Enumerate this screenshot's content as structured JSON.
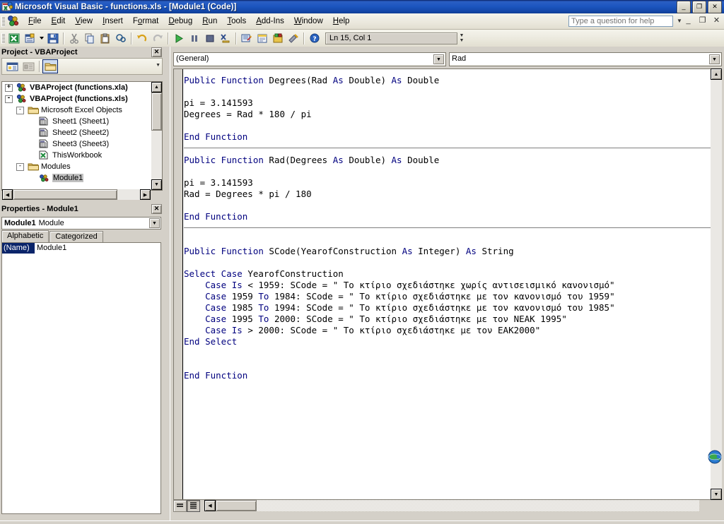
{
  "window": {
    "title": "Microsoft Visual Basic - functions.xls - [Module1 (Code)]",
    "app_icon": "vb-excel-icon",
    "buttons": {
      "minimize": "_",
      "restore": "❐",
      "close": "✕"
    }
  },
  "menubar": {
    "items": [
      {
        "label": "File",
        "accel": "F"
      },
      {
        "label": "Edit",
        "accel": "E"
      },
      {
        "label": "View",
        "accel": "V"
      },
      {
        "label": "Insert",
        "accel": "I"
      },
      {
        "label": "Format",
        "accel": "o"
      },
      {
        "label": "Debug",
        "accel": "D"
      },
      {
        "label": "Run",
        "accel": "R"
      },
      {
        "label": "Tools",
        "accel": "T"
      },
      {
        "label": "Add-Ins",
        "accel": "A"
      },
      {
        "label": "Window",
        "accel": "W"
      },
      {
        "label": "Help",
        "accel": "H"
      }
    ],
    "help_box_placeholder": "Type a question for help",
    "mdi_buttons": {
      "minimize": "_",
      "restore": "❐",
      "close": "✕"
    }
  },
  "toolbar": {
    "buttons": [
      "view-excel-icon",
      "insert-userform-icon",
      "save-icon",
      "cut-icon",
      "copy-icon",
      "paste-icon",
      "find-icon",
      "undo-icon",
      "redo-icon",
      "run-icon",
      "break-icon",
      "reset-icon",
      "design-mode-icon",
      "project-explorer-icon",
      "properties-window-icon",
      "object-browser-icon",
      "toolbox-icon",
      "help-icon"
    ],
    "position_indicator": "Ln 15, Col 1"
  },
  "project_explorer": {
    "title": "Project - VBAProject",
    "close_label": "✕",
    "toolbar_buttons": [
      "view-code-icon",
      "view-object-icon",
      "toggle-folders-icon"
    ],
    "tree": [
      {
        "label": "VBAProject (functions.xla)",
        "icon": "vbaproject-icon",
        "indent": 0,
        "expander": "+",
        "bold": true,
        "selected": false
      },
      {
        "label": "VBAProject (functions.xls)",
        "icon": "vbaproject-icon",
        "indent": 0,
        "expander": "-",
        "bold": true,
        "selected": false
      },
      {
        "label": "Microsoft Excel Objects",
        "icon": "folder-icon",
        "indent": 1,
        "expander": "-",
        "bold": false,
        "selected": false
      },
      {
        "label": "Sheet1 (Sheet1)",
        "icon": "worksheet-icon",
        "indent": 2,
        "expander": "",
        "bold": false,
        "selected": false
      },
      {
        "label": "Sheet2 (Sheet2)",
        "icon": "worksheet-icon",
        "indent": 2,
        "expander": "",
        "bold": false,
        "selected": false
      },
      {
        "label": "Sheet3 (Sheet3)",
        "icon": "worksheet-icon",
        "indent": 2,
        "expander": "",
        "bold": false,
        "selected": false
      },
      {
        "label": "ThisWorkbook",
        "icon": "workbook-icon",
        "indent": 2,
        "expander": "",
        "bold": false,
        "selected": false
      },
      {
        "label": "Modules",
        "icon": "folder-icon",
        "indent": 1,
        "expander": "-",
        "bold": false,
        "selected": false
      },
      {
        "label": "Module1",
        "icon": "module-icon",
        "indent": 2,
        "expander": "",
        "bold": false,
        "selected": true
      }
    ]
  },
  "properties_window": {
    "title": "Properties - Module1",
    "close_label": "✕",
    "object_name": "Module1",
    "object_type": "Module",
    "tabs": [
      {
        "label": "Alphabetic",
        "active": true
      },
      {
        "label": "Categorized",
        "active": false
      }
    ],
    "rows": [
      {
        "key": "(Name)",
        "value": "Module1"
      }
    ]
  },
  "code_window": {
    "object_combo": "(General)",
    "procedure_combo": "Rad",
    "view_buttons": [
      "procedure-view-icon",
      "full-module-view-icon"
    ],
    "colors": {
      "keyword": "#00007f",
      "text": "#000000",
      "background": "#ffffff"
    },
    "code_blocks": [
      {
        "lines": [
          [
            {
              "t": "Public Function ",
              "k": true
            },
            {
              "t": "Degrees(Rad ",
              "k": false
            },
            {
              "t": "As ",
              "k": true
            },
            {
              "t": "Double) ",
              "k": false
            },
            {
              "t": "As ",
              "k": true
            },
            {
              "t": "Double",
              "k": false
            }
          ],
          [],
          [
            {
              "t": "pi = 3.141593",
              "k": false
            }
          ],
          [
            {
              "t": "Degrees = Rad * 180 / pi",
              "k": false
            }
          ],
          [],
          [
            {
              "t": "End Function",
              "k": true
            }
          ]
        ]
      },
      {
        "lines": [
          [
            {
              "t": "Public Function ",
              "k": true
            },
            {
              "t": "Rad(Degrees ",
              "k": false
            },
            {
              "t": "As ",
              "k": true
            },
            {
              "t": "Double) ",
              "k": false
            },
            {
              "t": "As ",
              "k": true
            },
            {
              "t": "Double",
              "k": false
            }
          ],
          [],
          [
            {
              "t": "pi = 3.141593",
              "k": false
            }
          ],
          [
            {
              "t": "Rad = Degrees * pi / 180",
              "k": false
            }
          ],
          [],
          [
            {
              "t": "End Function",
              "k": true
            }
          ]
        ]
      },
      {
        "lines": [
          [],
          [
            {
              "t": "Public Function ",
              "k": true
            },
            {
              "t": "SCode(YearofConstruction ",
              "k": false
            },
            {
              "t": "As ",
              "k": true
            },
            {
              "t": "Integer) ",
              "k": false
            },
            {
              "t": "As ",
              "k": true
            },
            {
              "t": "String",
              "k": false
            }
          ],
          [],
          [
            {
              "t": "Select Case ",
              "k": true
            },
            {
              "t": "YearofConstruction",
              "k": false
            }
          ],
          [
            {
              "t": "    Case Is ",
              "k": true
            },
            {
              "t": "< 1959: SCode = \" Το κτίριο σχεδιάστηκε χωρίς αντισεισμικό κανονισμό\"",
              "k": false
            }
          ],
          [
            {
              "t": "    Case ",
              "k": true
            },
            {
              "t": "1959 ",
              "k": false
            },
            {
              "t": "To ",
              "k": true
            },
            {
              "t": "1984: SCode = \" Το κτίριο σχεδιάστηκε με τον κανονισμό του 1959\"",
              "k": false
            }
          ],
          [
            {
              "t": "    Case ",
              "k": true
            },
            {
              "t": "1985 ",
              "k": false
            },
            {
              "t": "To ",
              "k": true
            },
            {
              "t": "1994: SCode = \" Το κτίριο σχεδιάστηκε με τον κανονισμό του 1985\"",
              "k": false
            }
          ],
          [
            {
              "t": "    Case ",
              "k": true
            },
            {
              "t": "1995 ",
              "k": false
            },
            {
              "t": "To ",
              "k": true
            },
            {
              "t": "2000: SCode = \" Το κτίριο σχεδιάστηκε με τον ΝΕΑΚ 1995\"",
              "k": false
            }
          ],
          [
            {
              "t": "    Case Is ",
              "k": true
            },
            {
              "t": "> 2000: SCode = \" Το κτίριο σχεδιάστηκε με τον ΕΑΚ2000\"",
              "k": false
            }
          ],
          [
            {
              "t": "End Select",
              "k": true
            }
          ],
          [],
          [],
          [
            {
              "t": "End Function",
              "k": true
            }
          ]
        ]
      }
    ]
  }
}
